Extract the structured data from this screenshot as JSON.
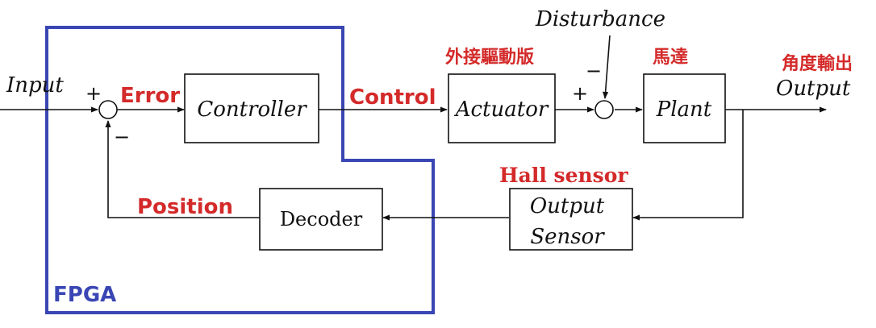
{
  "colors": {
    "accent_red": "#d42a2a",
    "fpga_blue": "#3a46b4",
    "line": "#111111"
  },
  "blocks": {
    "controller": "Controller",
    "actuator": "Actuator",
    "plant": "Plant",
    "decoder": "Decoder",
    "output_sensor_line1": "Output",
    "output_sensor_line2": "Sensor"
  },
  "signals": {
    "input": "Input",
    "output": "Output",
    "disturbance": "Disturbance",
    "error": "Error",
    "control": "Control",
    "position": "Position"
  },
  "annotations": {
    "hall_sensor": "Hall sensor",
    "driver_board": "外接驅動版",
    "motor": "馬達",
    "angle_output": "角度輸出",
    "fpga": "FPGA"
  },
  "signs": {
    "sum1_plus": "+",
    "sum1_minus": "−",
    "sum2_plus": "+",
    "sum2_minus": "−"
  }
}
